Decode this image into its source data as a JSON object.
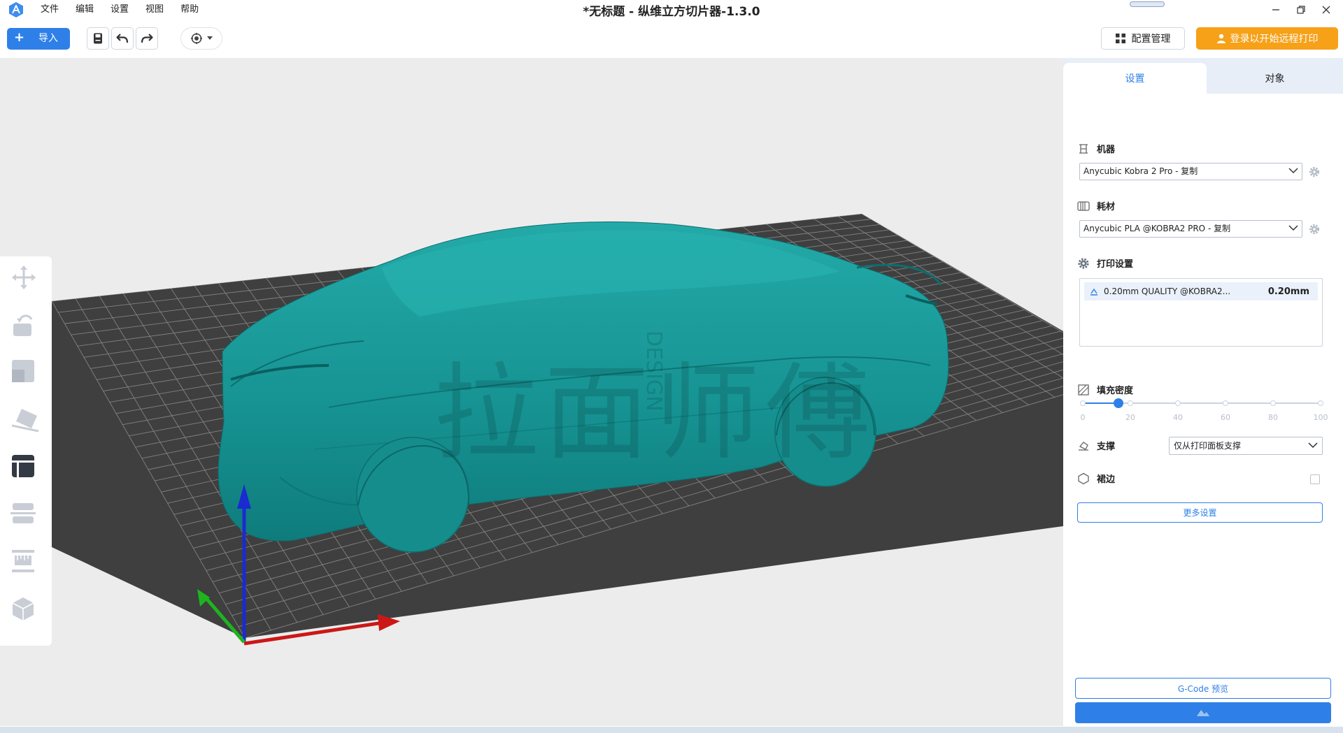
{
  "window": {
    "title": "*无标题 - 纵维立方切片器-1.3.0"
  },
  "menu": {
    "items": [
      "文件",
      "编辑",
      "设置",
      "视图",
      "帮助"
    ]
  },
  "toolbar": {
    "import_label": "导入",
    "import_plus": "+",
    "save_icon": "save-icon",
    "undo_icon": "undo-icon",
    "redo_icon": "redo-icon",
    "view_icon": "view-orientation-icon",
    "config_manage_label": "配置管理",
    "login_label": "登录以开始远程打印"
  },
  "viewport": {
    "watermark_text": "拉面师傅",
    "watermark_vertical": "DESIGN",
    "model_color": "#1a9a9a",
    "bed_color": "#3f3f3f",
    "left_tools": [
      {
        "name": "move-tool",
        "icon": "move-icon"
      },
      {
        "name": "rotate-tool",
        "icon": "rotate-icon"
      },
      {
        "name": "scale-tool",
        "icon": "scale-icon"
      },
      {
        "name": "lay-flat-tool",
        "icon": "lay-flat-icon"
      },
      {
        "name": "support-paint-tool",
        "icon": "support-paint-icon"
      },
      {
        "name": "cut-tool",
        "icon": "cut-icon"
      },
      {
        "name": "measure-tool",
        "icon": "measure-icon"
      },
      {
        "name": "model-library-tool",
        "icon": "cube-icon"
      }
    ]
  },
  "panel": {
    "tabs": [
      {
        "label": "设置",
        "active": true
      },
      {
        "label": "对象",
        "active": false
      }
    ],
    "machine": {
      "label": "机器",
      "value": "Anycubic Kobra 2 Pro - 复制"
    },
    "filament": {
      "label": "耗材",
      "value": "Anycubic PLA @KOBRA2 PRO - 复制"
    },
    "print_settings": {
      "label": "打印设置",
      "profile_name": "0.20mm QUALITY @KOBRA2...",
      "profile_value": "0.20mm"
    },
    "infill": {
      "label": "填充密度",
      "value_percent": 15,
      "ticks": [
        "0",
        "20",
        "40",
        "60",
        "80",
        "100"
      ]
    },
    "support": {
      "label": "支撑",
      "value": "仅从打印面板支撑"
    },
    "brim": {
      "label": "裙边",
      "checked": false
    },
    "more_settings_label": "更多设置",
    "gcode_preview_label": "G-Code 预览"
  },
  "colors": {
    "accent": "#2e80e8",
    "login": "#f6a118"
  }
}
